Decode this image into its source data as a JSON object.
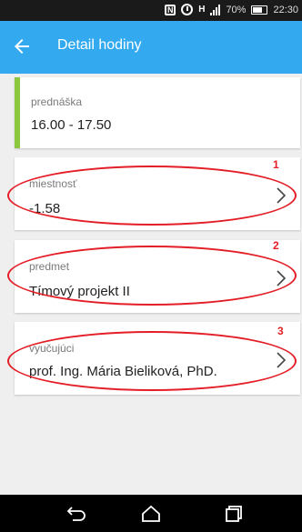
{
  "status_bar": {
    "battery": "70%",
    "time": "22:30",
    "icons": [
      "nfc-icon",
      "alarm-icon",
      "hplus-icon",
      "signal-icon",
      "battery-icon"
    ],
    "battery_level": 0.7
  },
  "app_bar": {
    "title": "Detail hodiny",
    "back_icon": "arrow-left-icon",
    "color": "#33aaf0"
  },
  "lesson": {
    "type_label": "prednáška",
    "time": "16.00 - 17.50",
    "accent_color": "#8dc63f"
  },
  "details": [
    {
      "label": "miestnosť",
      "value": "-1.58",
      "marker": "1"
    },
    {
      "label": "predmet",
      "value": "Tímový projekt II",
      "marker": "2"
    },
    {
      "label": "vyučujúci",
      "value": "prof. Ing. Mária Bieliková, PhD.",
      "marker": "3"
    }
  ],
  "annotation_color": "#e41e26",
  "nav_bar": {
    "icons": [
      "back-nav-icon",
      "home-nav-icon",
      "recents-nav-icon"
    ]
  }
}
